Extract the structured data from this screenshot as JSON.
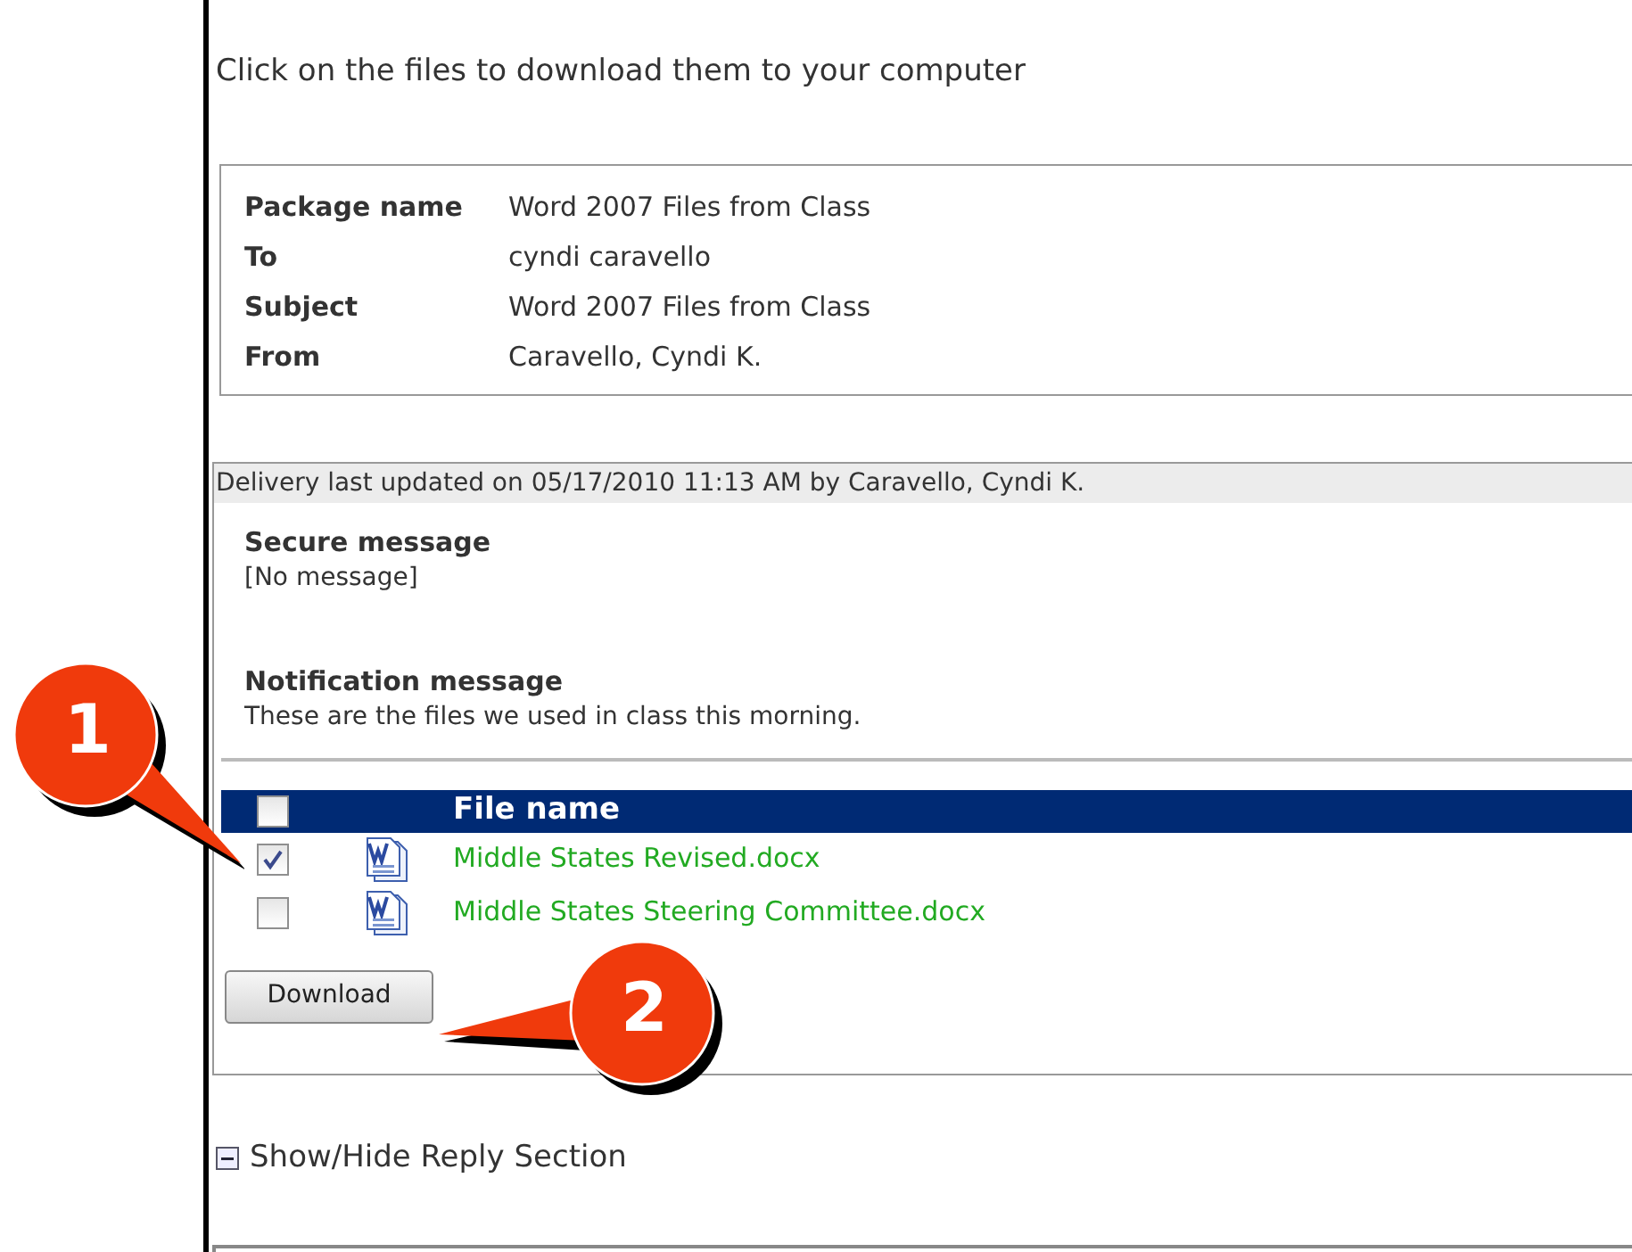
{
  "instruction": "Click on the files to download them to your computer",
  "package_details": [
    {
      "label": "Package name",
      "value": "Word 2007 Files from Class"
    },
    {
      "label": "To",
      "value": "cyndi caravello"
    },
    {
      "label": "Subject",
      "value": "Word 2007 Files from Class"
    },
    {
      "label": "From",
      "value": "Caravello, Cyndi K."
    }
  ],
  "delivery": {
    "updated": "Delivery last updated on 05/17/2010 11:13 AM by Caravello, Cyndi K.",
    "sections": [
      {
        "title": "Secure message",
        "body": "[No message]"
      },
      {
        "title": "Notification message",
        "body": "These are the files we used in class this morning."
      }
    ]
  },
  "file_table": {
    "header_checked": false,
    "column": "File name",
    "rows": [
      {
        "name": "Middle States Revised.docx",
        "checked": true
      },
      {
        "name": "Middle States Steering Committee.docx",
        "checked": false
      }
    ]
  },
  "download_button": "Download",
  "reply_toggle": {
    "label": "Show/Hide Reply Section",
    "expanded": true
  },
  "callouts": [
    {
      "number": "1"
    },
    {
      "number": "2"
    }
  ]
}
